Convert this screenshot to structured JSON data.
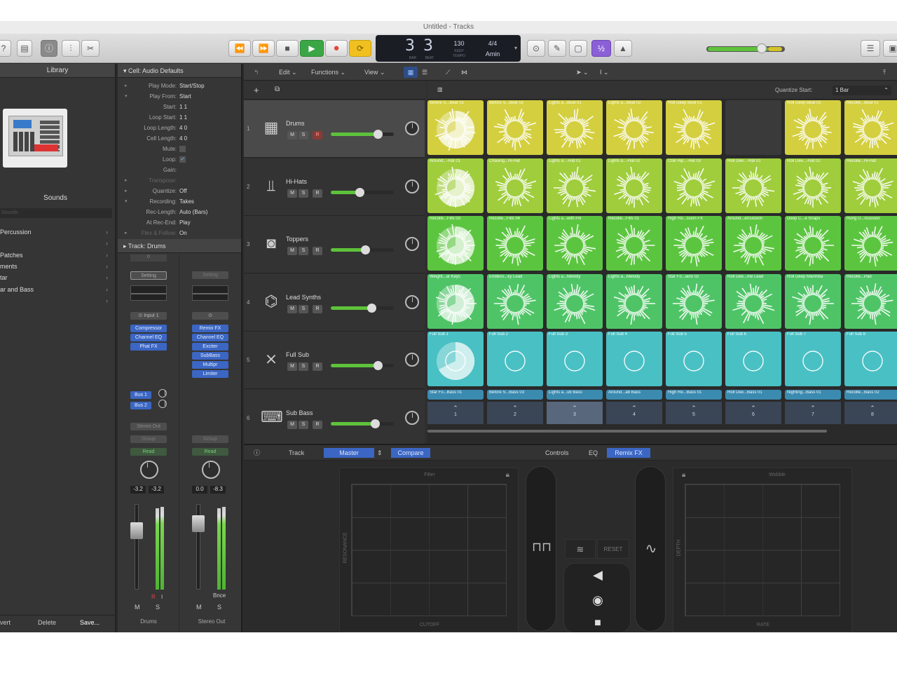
{
  "window": {
    "title": "Untitled - Tracks"
  },
  "transport": {
    "bar": "3",
    "beat": "3",
    "tempo": "130",
    "tempo_label": "KEEP",
    "tempo_sub": "TEMPO",
    "signature": "4/4",
    "key": "Amin",
    "bar_label": "BAR",
    "beat_label": "BEAT"
  },
  "toolbar": {
    "rewind": "⏪",
    "forward": "⏩",
    "stop": "■",
    "play": "▶",
    "record": "●",
    "cycle": "⟳"
  },
  "library": {
    "title": "Library",
    "sounds_label": "Sounds",
    "search_placeholder": "Sounds",
    "items": [
      "Percussion",
      "",
      "Patches",
      "ments",
      "tar",
      "ar and Bass",
      ""
    ],
    "footer": [
      "vert",
      "Delete",
      "Save..."
    ]
  },
  "inspector": {
    "region_header": "Cell: Audio Defaults",
    "rows": [
      {
        "k": "Play Mode:",
        "v": "Start/Stop"
      },
      {
        "k": "Play From:",
        "v": "Start"
      },
      {
        "k": "Start:",
        "v": "1  1"
      },
      {
        "k": "Loop Start:",
        "v": "1  1"
      },
      {
        "k": "Loop Length:",
        "v": "4  0"
      },
      {
        "k": "Cell Length:",
        "v": "4  0"
      },
      {
        "k": "Mute:",
        "v": ""
      },
      {
        "k": "Loop:",
        "v": "✓"
      },
      {
        "k": "Gain:",
        "v": ""
      },
      {
        "k": "Transpose:",
        "v": ""
      },
      {
        "k": "Quantize:",
        "v": "Off"
      },
      {
        "k": "Recording:",
        "v": "Takes"
      },
      {
        "k": "Rec-Length:",
        "v": "Auto (Bars)"
      },
      {
        "k": "At Rec-End:",
        "v": "Play"
      },
      {
        "k": "Flex & Follow:",
        "v": "On"
      }
    ],
    "track_header": "Track:  Drums",
    "strip1": {
      "setting": "Setting",
      "input": "Input 1",
      "slots": [
        "Compressor",
        "Channel EQ",
        "Phat FX"
      ],
      "sends": [
        "Bus 1",
        "Bus 2"
      ],
      "output": "Stereo Out",
      "group": "Group",
      "auto": "Read",
      "pan_l": "-3.2",
      "pan_r": "-3.2",
      "name": "Drums",
      "mute": "M",
      "solo": "S",
      "rec": "R",
      "inmon": "I"
    },
    "strip2": {
      "setting": "Setting",
      "slots": [
        "Remix FX",
        "Channel EQ",
        "Exciter",
        "SubBass",
        "Multipr",
        "Limiter"
      ],
      "group": "Group",
      "auto": "Read",
      "pan_l": "0.0",
      "pan_r": "-8.3",
      "name": "Stereo Out",
      "mute": "M",
      "solo": "S",
      "bnce": "Bnce"
    }
  },
  "tracks_area": {
    "menus": [
      "Edit",
      "Functions",
      "View"
    ],
    "quantize_label": "Quantize Start:",
    "quantize_value": "1 Bar",
    "tracks": [
      {
        "num": "1",
        "name": "Drums",
        "icon": "drum-machine-icon",
        "vol": 0.74
      },
      {
        "num": "2",
        "name": "Hi-Hats",
        "icon": "hihat-icon",
        "vol": 0.46
      },
      {
        "num": "3",
        "name": "Toppers",
        "icon": "snare-icon",
        "vol": 0.54
      },
      {
        "num": "4",
        "name": "Lead Synths",
        "icon": "synth-icon",
        "vol": 0.64
      },
      {
        "num": "5",
        "name": "Full Sub",
        "icon": "keyboard-stand-icon",
        "vol": 0.74
      },
      {
        "num": "6",
        "name": "Sub Bass",
        "icon": "keyboard-icon",
        "vol": 0.7
      }
    ],
    "track_buttons": {
      "mute": "M",
      "solo": "S",
      "rec": "R"
    }
  },
  "grid": {
    "rows": [
      {
        "color": "#d3cf3f",
        "cells": [
          "Before S...Beat 01",
          "Before S...Beat 02",
          "Lights a...Beat 01",
          "Lights a...Beat 02",
          "Roll Deep Beat 01",
          "",
          "Roll Deep Beat 02",
          "Recolle...Beat 01"
        ]
      },
      {
        "color": "#9fcd3c",
        "cells": [
          "Around...-Hat 01",
          "Chasing...Hi-Hat",
          "Lights a...-Hat 01",
          "Lights a...-Hat 02",
          "Chill Hip...-Hat 03",
          "Roll Dee...-Hat 01",
          "Roll Dee...-Hat 02",
          "Recolle...Hi-Hat"
        ]
      },
      {
        "color": "#5cc540",
        "cells": [
          "Recolle...Fills 03",
          "Recolle...Fills 04",
          "Lights a...with Fill",
          "Recolle...Fills 01",
          "High Re...ssion FX",
          "Around...ercussion",
          "Deep C...e Snaps",
          "Hung U...rcussion"
        ]
      },
      {
        "color": "#4fc467",
        "cells": [
          "Weight...ar Keys",
          "Endless...ky Lead",
          "Lights a...Melody",
          "Lights a...Melody",
          "Star Fo...iano 02",
          "Roll Dee...me Lead",
          "Roll Deep Marimba",
          "Recolle...Pad"
        ]
      },
      {
        "color": "#49c0c4",
        "cells": [
          "Full Sub 1",
          "Full Sub 2",
          "Full Sub 3",
          "Full Sub 4",
          "Full Sub 5",
          "Full Sub 6",
          "Full Sub 7",
          "Full Sub 8"
        ]
      },
      {
        "color": "#3b8ab0",
        "cells": [
          "Star Fo...Bass 01",
          "Before S...Bass 03",
          "Lights a...ub Bass",
          "Around...ab Bass",
          "High Re...Bass 01",
          "Roll Dee...Bass 01",
          "Nighting...Bass 01",
          "Recolle...Bass 02"
        ]
      }
    ],
    "scenes": [
      "1",
      "2",
      "3",
      "4",
      "5",
      "6",
      "7",
      "8"
    ]
  },
  "smart_controls": {
    "tabs": [
      "Track",
      "Master",
      "Compare"
    ],
    "right_tabs": [
      "Controls",
      "EQ",
      "Remix FX"
    ],
    "filter_label": "Filter",
    "cutoff_label": "CUTOFF",
    "resonance_label": "RESONANCE",
    "wobble_label": "Wobble",
    "rate_label": "RATE",
    "depth_label": "DEPTH",
    "reset_label": "RESET"
  },
  "colors": {
    "play": "#3aa645",
    "record": "#e0493b",
    "cycle": "#f0c020",
    "remix_selected": "#3b66c4",
    "purple": "#8b5fd6"
  }
}
